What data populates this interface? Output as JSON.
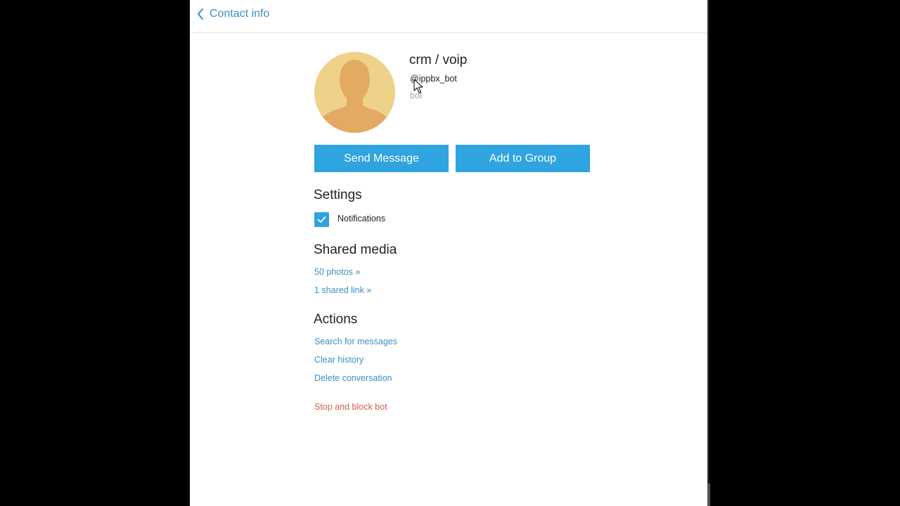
{
  "header": {
    "back_label": "Contact info"
  },
  "profile": {
    "name": "crm / voip",
    "username": "@ippbx_bot",
    "status": "bot"
  },
  "buttons": {
    "send_message": "Send Message",
    "add_to_group": "Add to Group"
  },
  "settings": {
    "title": "Settings",
    "notifications_label": "Notifications",
    "notifications_checked": true
  },
  "shared_media": {
    "title": "Shared media",
    "photos": "50 photos »",
    "links": "1 shared link »"
  },
  "actions": {
    "title": "Actions",
    "search": "Search for messages",
    "clear": "Clear history",
    "delete": "Delete conversation",
    "block": "Stop and block bot"
  },
  "colors": {
    "accent": "#2fa4e0",
    "link": "#3a8fc7",
    "danger": "#d0614b",
    "avatar_bg": "#efd28a",
    "avatar_figure": "#e4aa63"
  },
  "icons": {
    "back": "chevron-left-icon",
    "check": "checkmark-icon",
    "avatar": "default-user-avatar-icon"
  }
}
